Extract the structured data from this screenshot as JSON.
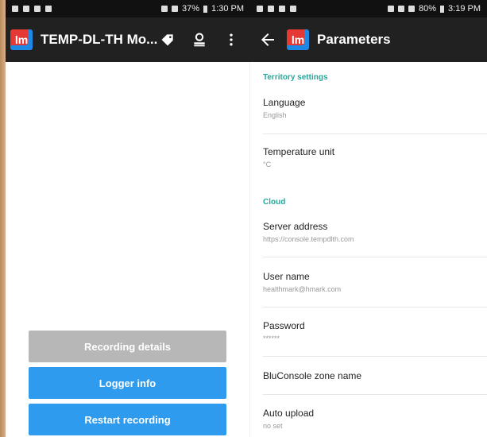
{
  "left_status": {
    "time": "1:30 PM",
    "battery": "37%"
  },
  "right_status": {
    "time": "3:19 PM",
    "battery": "80%"
  },
  "left_toolbar": {
    "logo_text": "lm",
    "title": "TEMP-DL-TH Mo..."
  },
  "right_toolbar": {
    "logo_text": "lm",
    "title": "Parameters"
  },
  "buttons": {
    "recording_details": "Recording details",
    "logger_info": "Logger info",
    "restart_recording": "Restart recording"
  },
  "settings": {
    "territory_header": "Territory settings",
    "language": {
      "title": "Language",
      "summary": "English"
    },
    "temperature_unit": {
      "title": "Temperature unit",
      "summary": "°C"
    },
    "cloud_header": "Cloud",
    "server_address": {
      "title": "Server address",
      "summary": "https://console.tempdlth.com"
    },
    "user_name": {
      "title": "User name",
      "summary": "healthmark@hmark.com"
    },
    "password": {
      "title": "Password",
      "summary": "******"
    },
    "bluconsole_zone": {
      "title": "BluConsole zone name"
    },
    "auto_upload": {
      "title": "Auto upload",
      "summary": "no set"
    }
  },
  "colors": {
    "accent_teal": "#26a69a",
    "button_blue": "#2f9bef",
    "button_gray": "#b7b7b7",
    "toolbar": "#212121"
  },
  "icons": [
    "tag-icon",
    "user-switch-icon",
    "more-vert-icon",
    "back-arrow-icon"
  ]
}
